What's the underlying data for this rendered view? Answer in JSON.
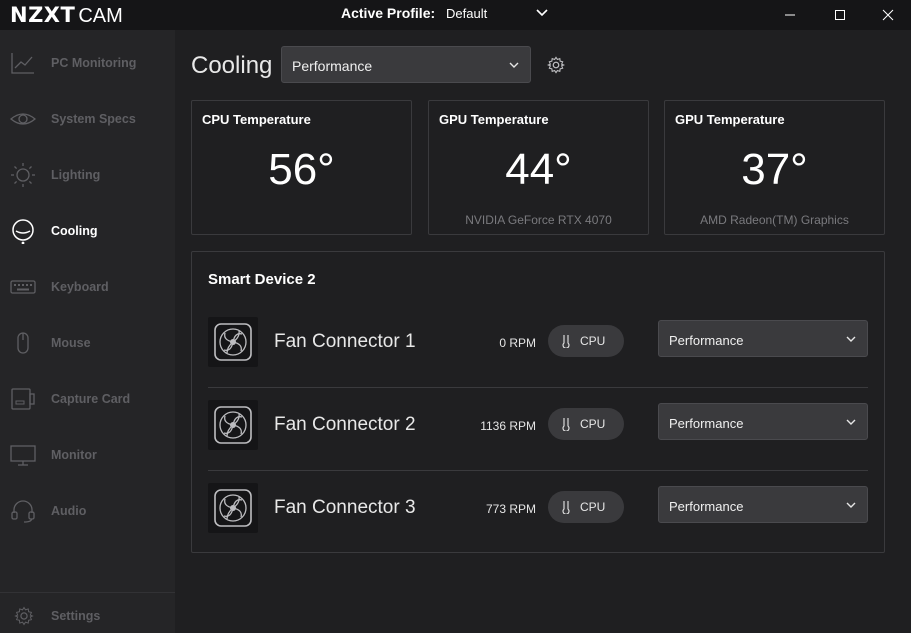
{
  "app": {
    "logo_brand": "NZXT",
    "logo_product": "CAM"
  },
  "titlebar": {
    "profile_label": "Active Profile:",
    "profile_value": "Default",
    "icons": [
      "minimize-icon",
      "maximize-icon",
      "close-icon"
    ]
  },
  "sidebar": {
    "items": [
      {
        "label": "PC Monitoring",
        "icon": "line-chart-icon",
        "active": false
      },
      {
        "label": "System Specs",
        "icon": "eye-icon",
        "active": false
      },
      {
        "label": "Lighting",
        "icon": "sun-icon",
        "active": false
      },
      {
        "label": "Cooling",
        "icon": "cooling-icon",
        "active": true
      },
      {
        "label": "Keyboard",
        "icon": "keyboard-icon",
        "active": false
      },
      {
        "label": "Mouse",
        "icon": "mouse-icon",
        "active": false
      },
      {
        "label": "Capture Card",
        "icon": "capture-card-icon",
        "active": false
      },
      {
        "label": "Monitor",
        "icon": "monitor-icon",
        "active": false
      },
      {
        "label": "Audio",
        "icon": "headset-icon",
        "active": false
      }
    ],
    "settings_label": "Settings"
  },
  "main": {
    "title": "Cooling",
    "profile_select": "Performance",
    "temps": [
      {
        "title": "CPU Temperature",
        "value": "56°",
        "sub": ""
      },
      {
        "title": "GPU Temperature",
        "value": "44°",
        "sub": "NVIDIA GeForce RTX 4070"
      },
      {
        "title": "GPU Temperature",
        "value": "37°",
        "sub": "AMD Radeon(TM) Graphics"
      }
    ],
    "device": {
      "title": "Smart Device 2",
      "fans": [
        {
          "name": "Fan Connector 1",
          "rpm": "0 RPM",
          "source": "CPU",
          "profile": "Performance"
        },
        {
          "name": "Fan Connector 2",
          "rpm": "1136 RPM",
          "source": "CPU",
          "profile": "Performance"
        },
        {
          "name": "Fan Connector 3",
          "rpm": "773 RPM",
          "source": "CPU",
          "profile": "Performance"
        }
      ]
    }
  },
  "colors": {
    "background": "#1f1f21",
    "sidebar": "#252527",
    "titlebar": "#151517",
    "control": "#3a3a3d",
    "inactive_text": "#5f5f63",
    "active_text": "#ffffff"
  }
}
